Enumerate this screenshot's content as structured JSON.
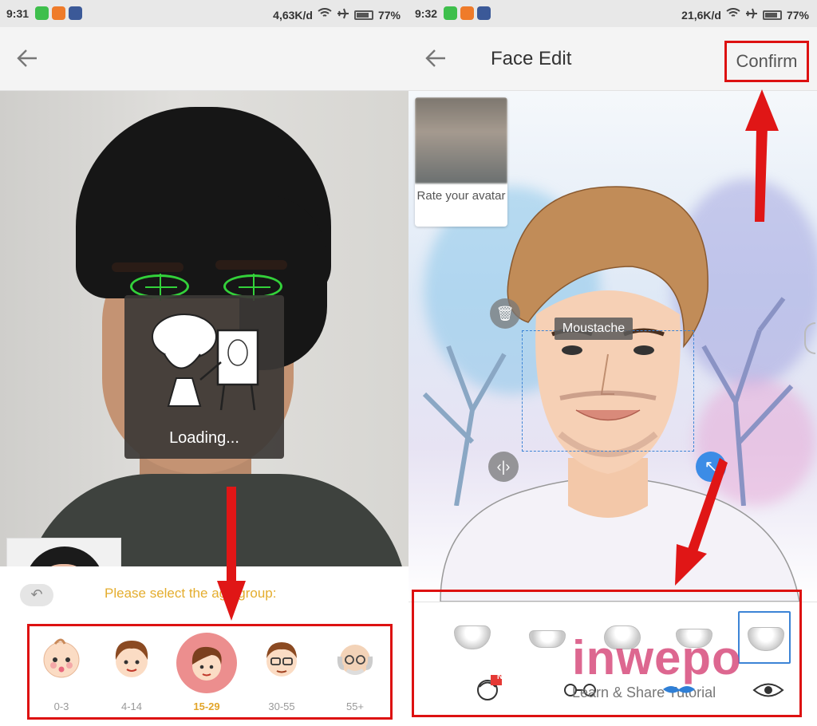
{
  "left": {
    "status": {
      "time": "9:31",
      "network": "4,63K/d",
      "battery": "77%"
    },
    "loading_text": "Loading...",
    "prompt": "Please select the age group:",
    "age_groups": [
      {
        "label": "0-3"
      },
      {
        "label": "4-14"
      },
      {
        "label": "15-29",
        "selected": true
      },
      {
        "label": "30-55"
      },
      {
        "label": "55+"
      }
    ]
  },
  "right": {
    "status": {
      "time": "9:32",
      "network": "21,6K/d",
      "battery": "77%"
    },
    "title": "Face Edit",
    "confirm": "Confirm",
    "rate": "Rate your avatar",
    "tooltip": "Moustache",
    "nav_text": "Learn & Share Tutorial",
    "badge": "N",
    "watermark": "inwepo"
  },
  "colors": {
    "highlight": "#d11111",
    "accent_blue": "#3c84d6",
    "age_selected": "#ec8e8e",
    "prompt": "#e4ad2e"
  }
}
